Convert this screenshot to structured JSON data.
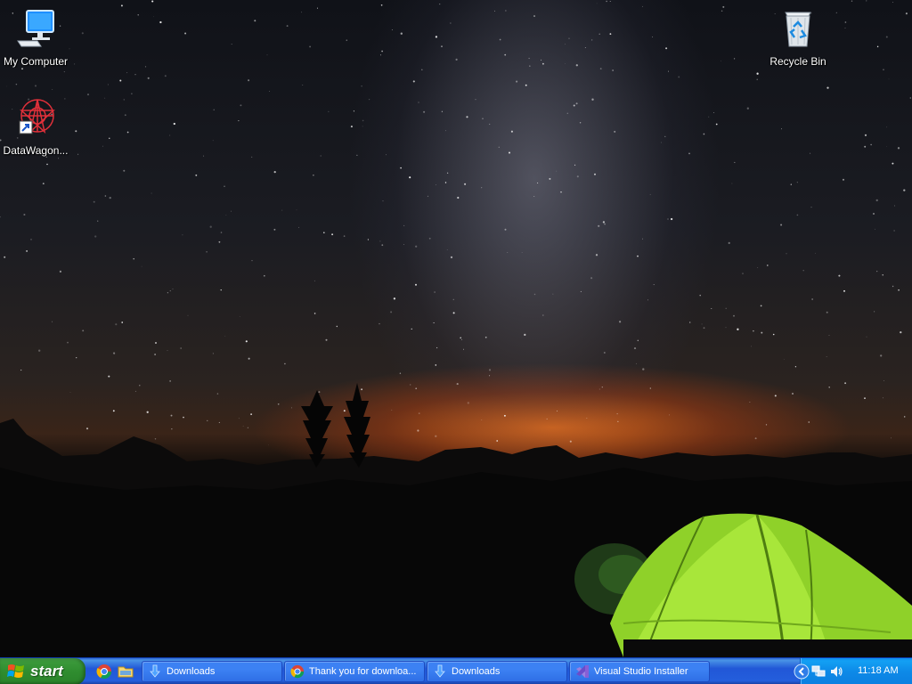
{
  "desktop": {
    "icons": [
      {
        "id": "my-computer",
        "label": "My Computer",
        "icon": "computer-icon"
      },
      {
        "id": "datawagon",
        "label": "DataWagon...",
        "icon": "datawagon-shortcut-icon"
      },
      {
        "id": "recycle-bin",
        "label": "Recycle Bin",
        "icon": "recycle-bin-icon"
      }
    ]
  },
  "taskbar": {
    "start_label": "start",
    "quick_launch": [
      {
        "name": "chrome",
        "icon": "chrome-icon"
      },
      {
        "name": "explorer",
        "icon": "folder-icon"
      }
    ],
    "buttons": [
      {
        "label": "Downloads",
        "icon": "download-arrow-icon"
      },
      {
        "label": "Thank you for downloa...",
        "icon": "chrome-icon"
      },
      {
        "label": "Downloads",
        "icon": "download-arrow-icon"
      },
      {
        "label": "Visual Studio Installer",
        "icon": "visual-studio-icon"
      }
    ],
    "tray": {
      "icons": [
        "chevron-left-icon",
        "network-icon",
        "volume-icon"
      ],
      "clock": "11:18 AM"
    }
  },
  "colors": {
    "taskbar_blue": "#245edc",
    "start_green": "#2f8d2f",
    "tray_blue": "#0d8ae8",
    "sky_glow": "#e06e1e",
    "tent_green": "#9bdc2a"
  }
}
